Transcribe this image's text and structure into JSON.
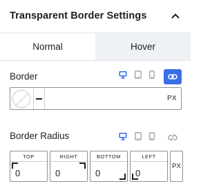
{
  "header": {
    "title": "Transparent Border Settings",
    "collapse_icon": "chevron-up-icon"
  },
  "tabs": [
    {
      "label": "Normal",
      "active": true
    },
    {
      "label": "Hover",
      "active": false
    }
  ],
  "border": {
    "label": "Border",
    "devices": [
      "desktop-icon",
      "tablet-icon",
      "mobile-icon"
    ],
    "active_device": "desktop",
    "link_active": true,
    "color": "none",
    "style": "solid",
    "width_value": "",
    "unit": "PX"
  },
  "border_radius": {
    "label": "Border Radius",
    "devices": [
      "desktop-icon",
      "tablet-icon",
      "mobile-icon"
    ],
    "active_device": "desktop",
    "link_active": false,
    "fields": [
      {
        "label": "TOP",
        "value": "0"
      },
      {
        "label": "RIGHT",
        "value": "0"
      },
      {
        "label": "BOTTOM",
        "value": "0"
      },
      {
        "label": "LEFT",
        "value": "0"
      }
    ],
    "unit": "PX"
  },
  "colors": {
    "accent": "#3a6ee8",
    "active_device": "#3a6ee8",
    "inactive_icon": "#9a9ea4",
    "tab_inactive_bg": "#eef2f5",
    "text": "#1e1e1e"
  }
}
